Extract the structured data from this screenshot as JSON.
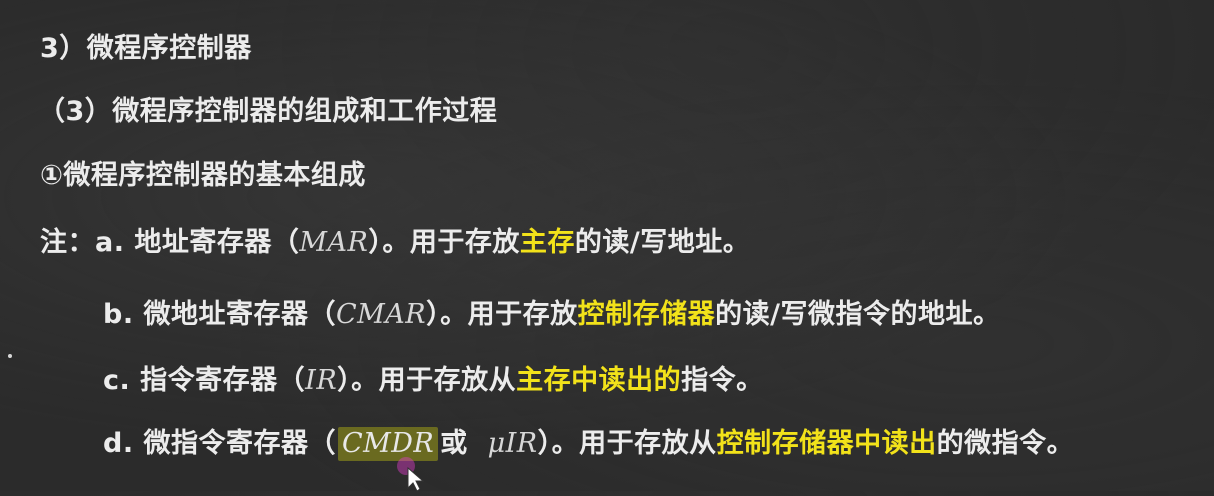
{
  "heading1": "3）微程序控制器",
  "heading2": "（3）微程序控制器的组成和工作过程",
  "heading3": "①微程序控制器的基本组成",
  "note": {
    "prefix": "注：",
    "a": {
      "label": "a. 地址寄存器（",
      "abbr": "MAR",
      "mid": "）。用于存放",
      "hl": "主存",
      "end": "的读/写地址。"
    },
    "b": {
      "label": "b. 微地址寄存器（",
      "abbr": "CMAR",
      "mid": "）。用于存放",
      "hl": "控制存储器",
      "end": "的读/写微指令的地址。"
    },
    "c": {
      "label": "c. 指令寄存器（",
      "abbr": "IR",
      "mid": "）。用于存放从",
      "hl": "主存中读出的",
      "end": "指令。"
    },
    "d": {
      "label": "d. 微指令寄存器（",
      "abbr": "CMDR",
      "or": "或",
      "abbr2": "μIR",
      "mid": "）。用于存放从",
      "hl": "控制存储器中读出",
      "end": "的微指令。"
    }
  },
  "colors": {
    "background": "#2b2b2b",
    "text": "#ececec",
    "highlight": "#f2e21a",
    "highlight_box": "#6a6a20"
  }
}
